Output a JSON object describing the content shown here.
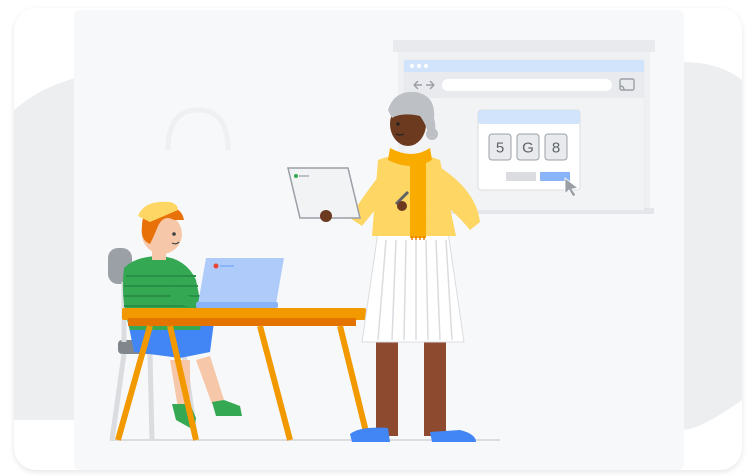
{
  "scene": {
    "captcha": {
      "characters": [
        "5",
        "G",
        "8"
      ]
    },
    "colors": {
      "background": "#f1f3f4",
      "card": "#f8f9fa",
      "browser_bar": "#d2e3fc",
      "submit_button": "#8ab4f8",
      "cancel_button": "#dadce0",
      "table": "#f29900",
      "woman_top": "#fdd663",
      "scarf": "#f9ab00",
      "boy_shirt": "#34a853",
      "boy_shorts": "#4285f4",
      "laptop": "#aecbfa"
    },
    "icons": [
      "cast-icon",
      "back-arrow-icon",
      "forward-arrow-icon",
      "cursor-icon",
      "chrome-logo-icon"
    ]
  }
}
